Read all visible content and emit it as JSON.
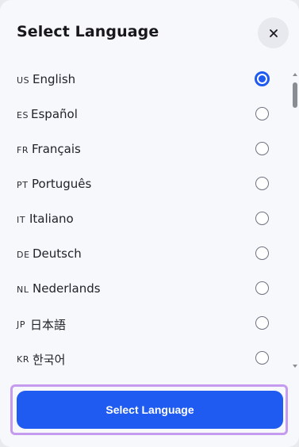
{
  "dialog": {
    "title": "Select Language"
  },
  "close": {
    "icon": "close-icon"
  },
  "languages": [
    {
      "code": "US",
      "name": "English",
      "selected": true
    },
    {
      "code": "ES",
      "name": "Español",
      "selected": false
    },
    {
      "code": "FR",
      "name": "Français",
      "selected": false
    },
    {
      "code": "PT",
      "name": "Português",
      "selected": false
    },
    {
      "code": "IT",
      "name": "Italiano",
      "selected": false
    },
    {
      "code": "DE",
      "name": "Deutsch",
      "selected": false
    },
    {
      "code": "NL",
      "name": "Nederlands",
      "selected": false
    },
    {
      "code": "JP",
      "name": "日本語",
      "selected": false
    },
    {
      "code": "KR",
      "name": "한국어",
      "selected": false
    }
  ],
  "footer": {
    "button_label": "Select Language"
  },
  "colors": {
    "accent": "#1f5bf0",
    "focus_ring": "#c49bee",
    "background": "#f7f8fb"
  }
}
